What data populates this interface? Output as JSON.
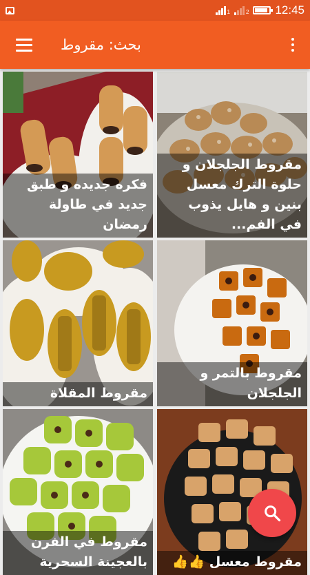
{
  "status_bar": {
    "time": "12:45",
    "sim1": "1",
    "sim2": "2",
    "icons": [
      "picture-notification-icon",
      "signal-sim1-icon",
      "signal-sim2-icon",
      "battery-icon"
    ],
    "battery_level_pct": 90
  },
  "app_bar": {
    "title": "بحث: مقروط",
    "menu_icon": "hamburger-menu-icon",
    "more_icon": "more-vertical-icon",
    "color": "#f15d22"
  },
  "recipes": [
    {
      "title": "مقروط الجلجلان و حلوة الترك معسل بنين و هايل يذوب في الفم...",
      "image": "sesame-makrout-photo"
    },
    {
      "title": "فكره جديده و طبق جديد في طاولة رمضان",
      "image": "pastry-rolls-photo"
    },
    {
      "title": "مقروط بالتمر و الجلجلان",
      "image": "date-sesame-makrout-photo"
    },
    {
      "title": "مقروط المقلاة",
      "image": "pan-makrout-photo"
    },
    {
      "title": "مقروط معسل 👍👍",
      "image": "honey-makrout-photo"
    },
    {
      "title": "مقروط في الفرن بالعجينة السحرية",
      "image": "oven-makrout-photo"
    }
  ],
  "fab": {
    "icon": "search-icon",
    "color": "#f0474a"
  }
}
